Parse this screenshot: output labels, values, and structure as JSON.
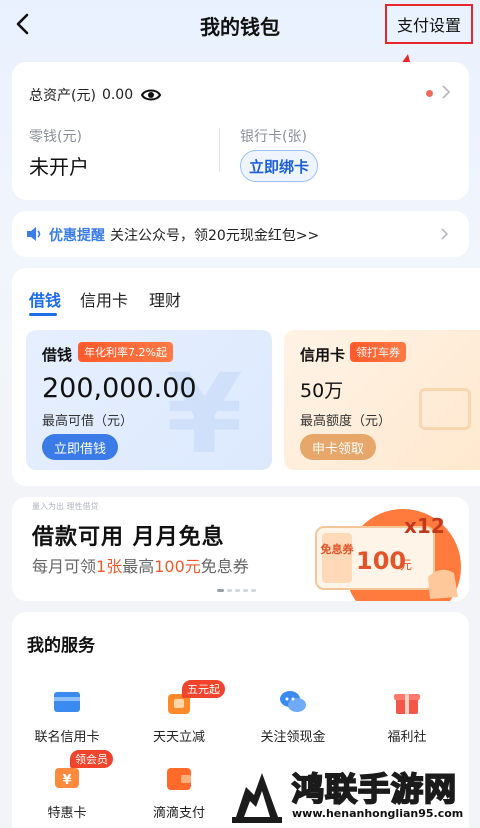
{
  "header": {
    "title": "我的钱包",
    "pay_settings": "支付设置"
  },
  "assets": {
    "label": "总资产(元)",
    "value": "0.00",
    "change_label": "零钱(元)",
    "change_value": "未开户",
    "bank_label": "银行卡(张)",
    "bind_button": "立即绑卡"
  },
  "notice": {
    "tag": "优惠提醒",
    "text": "关注公众号，领20元现金红包>>"
  },
  "products": {
    "tabs": [
      "借钱",
      "信用卡",
      "理财"
    ],
    "loan": {
      "title": "借钱",
      "badge": "年化利率7.2%起",
      "amount": "200,000.00",
      "sub": "最高可借（元）",
      "button": "立即借钱"
    },
    "credit": {
      "title": "信用卡",
      "badge": "领打车券",
      "amount": "50万",
      "sub": "最高额度（元）",
      "button": "申卡领取"
    }
  },
  "banner": {
    "tiny": "量入为出 理性借贷",
    "title": "借款可用  月月免息",
    "sub_a": "每月可领",
    "sub_b": "1张",
    "sub_c": "最高",
    "sub_d": "100元",
    "sub_e": "免息券",
    "coupon_left": "免息券",
    "coupon_value": "100",
    "coupon_unit": "元",
    "coupon_times": "x12"
  },
  "services": {
    "title": "我的服务",
    "items": [
      {
        "label": "联名信用卡",
        "icon": "card-icon"
      },
      {
        "label": "天天立减",
        "icon": "discount-bag-icon",
        "badge": "五元起"
      },
      {
        "label": "关注领现金",
        "icon": "chat-bubbles-icon"
      },
      {
        "label": "福利社",
        "icon": "gift-icon"
      },
      {
        "label": "特惠卡",
        "icon": "yen-card-icon",
        "badge": "领会员"
      },
      {
        "label": "滴滴支付",
        "icon": "wallet-icon"
      }
    ]
  },
  "watermark": {
    "text": "鸿联手游网",
    "url": "www.henanhonglian95.com"
  },
  "colors": {
    "primary": "#1f6ee8",
    "annotation_red": "#e8262b",
    "badge_red": "#f0442c",
    "credit_btn": "#e8a76a"
  }
}
